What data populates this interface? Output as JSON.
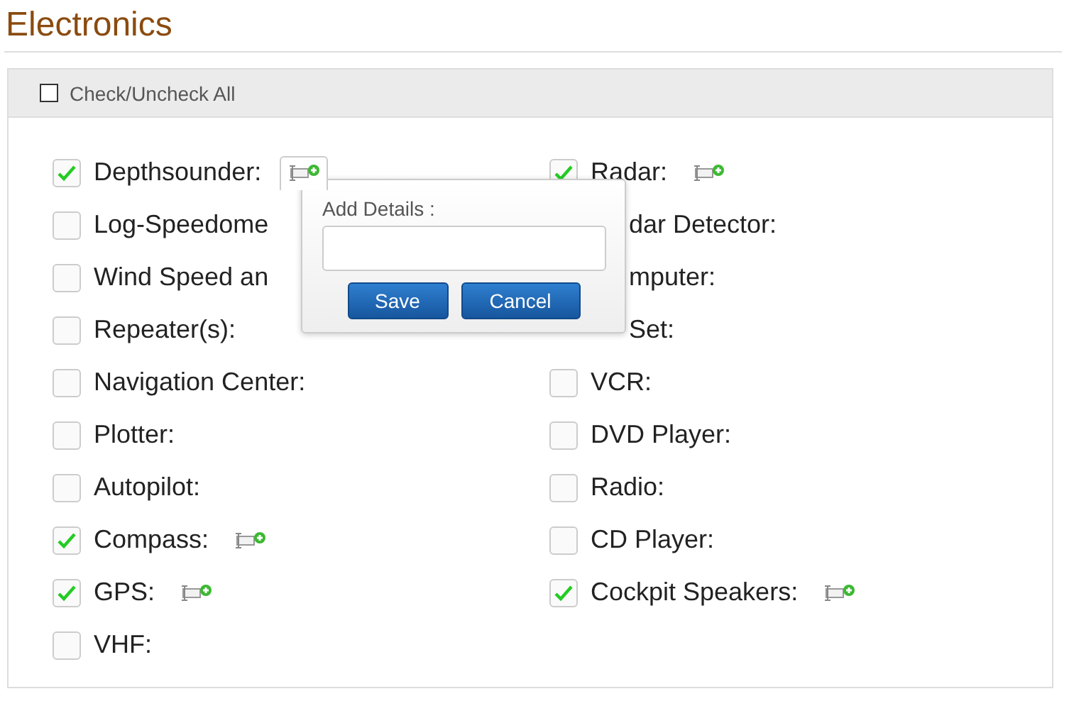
{
  "title": "Electronics",
  "check_all": {
    "label": "Check/Uncheck All",
    "checked": false
  },
  "columns": [
    {
      "items": [
        {
          "label": "Depthsounder:",
          "kind": "box",
          "checked": true,
          "has_details": true,
          "expanded": true
        },
        {
          "label": "Log-Speedome",
          "kind": "box",
          "checked": false,
          "has_details": false
        },
        {
          "label": "Wind Speed an",
          "kind": "box",
          "checked": false,
          "has_details": false
        },
        {
          "label": "Repeater(s):",
          "kind": "box",
          "checked": false,
          "has_details": false
        },
        {
          "label": "Navigation Center:",
          "kind": "box",
          "checked": false,
          "has_details": false
        },
        {
          "label": "Plotter:",
          "kind": "box",
          "checked": false,
          "has_details": false
        },
        {
          "label": "Autopilot:",
          "kind": "box",
          "checked": false,
          "has_details": false
        },
        {
          "label": "Compass:",
          "kind": "box",
          "checked": true,
          "has_details": true,
          "expanded": false
        },
        {
          "label": "GPS:",
          "kind": "box",
          "checked": true,
          "has_details": true,
          "expanded": false
        },
        {
          "label": "VHF:",
          "kind": "box",
          "checked": false,
          "has_details": false
        }
      ]
    },
    {
      "items": [
        {
          "label": "Radar:",
          "kind": "box",
          "checked": true,
          "has_details": true,
          "expanded": false
        },
        {
          "label": "dar Detector:",
          "kind": "covered"
        },
        {
          "label": "mputer:",
          "kind": "covered"
        },
        {
          "label": "Set:",
          "kind": "covered"
        },
        {
          "label": "VCR:",
          "kind": "box",
          "checked": false,
          "has_details": false
        },
        {
          "label": "DVD Player:",
          "kind": "box",
          "checked": false,
          "has_details": false
        },
        {
          "label": "Radio:",
          "kind": "box",
          "checked": false,
          "has_details": false
        },
        {
          "label": "CD Player:",
          "kind": "box",
          "checked": false,
          "has_details": false
        },
        {
          "label": "Cockpit Speakers:",
          "kind": "box",
          "checked": true,
          "has_details": true,
          "expanded": false
        }
      ]
    }
  ],
  "popover": {
    "label": "Add Details :",
    "buttons": [
      "Save",
      "Cancel"
    ]
  }
}
